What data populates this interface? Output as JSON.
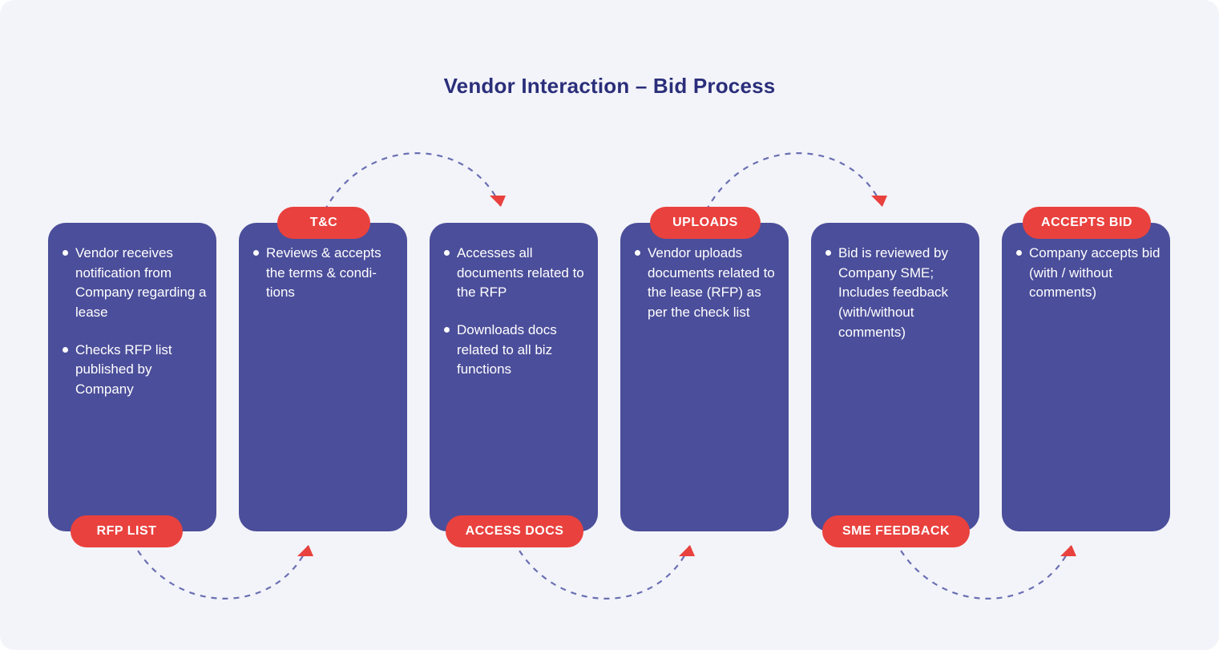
{
  "title": "Vendor Interaction – Bid Process",
  "cards": [
    {
      "badge": "RFP LIST",
      "badge_pos": "bottom",
      "items": [
        "Vendor receives notification from Company regarding a lease",
        "Checks RFP list published by Company"
      ]
    },
    {
      "badge": "T&C",
      "badge_pos": "top",
      "items": [
        "Reviews  & accepts the terms & condi­tions"
      ]
    },
    {
      "badge": "ACCESS DOCS",
      "badge_pos": "bottom",
      "items": [
        "Accesses all documents related to the RFP",
        "Downloads docs related to all biz functions"
      ]
    },
    {
      "badge": "UPLOADS",
      "badge_pos": "top",
      "items": [
        "Vendor uploads documents related to the lease (RFP) as per the check list"
      ]
    },
    {
      "badge": "SME FEEDBACK",
      "badge_pos": "bottom",
      "items": [
        "Bid is reviewed by Company SME; Includes feedback (with/without comments)"
      ]
    },
    {
      "badge": "ACCEPTS BID",
      "badge_pos": "top",
      "items": [
        "Company accepts bid (with / without comments)"
      ]
    }
  ],
  "colors": {
    "page_bg": "#f3f4f9",
    "card_bg": "#4b4e9a",
    "pill_bg": "#e9413e",
    "title": "#2a2e7a",
    "dash": "#6a6fb3"
  }
}
